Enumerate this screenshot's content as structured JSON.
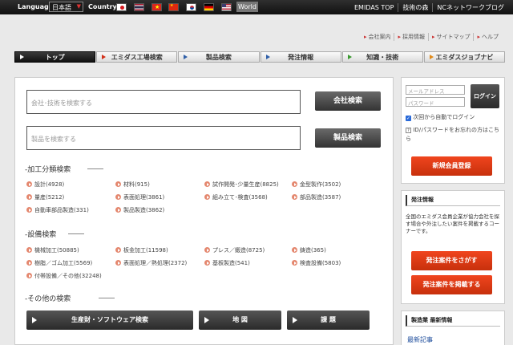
{
  "topbar": {
    "language_label": "Language:",
    "language_value": "日本語",
    "country_label": "Country:",
    "flags": [
      {
        "name": "japan-flag-icon",
        "color": "#ffffff",
        "accent": "#d61a1f"
      },
      {
        "name": "thailand-flag-icon",
        "color": "#2d2a4a",
        "accent": "#a51931"
      },
      {
        "name": "vietnam-flag-icon",
        "color": "#da251d",
        "accent": "#ffff00"
      },
      {
        "name": "china-flag-icon",
        "color": "#de2910",
        "accent": "#ffde00"
      },
      {
        "name": "korea-flag-icon",
        "color": "#ffffff",
        "accent": "#cd2e3a"
      },
      {
        "name": "germany-flag-icon",
        "color": "#000000",
        "accent": "#dd0000"
      },
      {
        "name": "usa-flag-icon",
        "color": "#b22234",
        "accent": "#3c3b6e"
      }
    ],
    "world_label": "World",
    "links": [
      "EMIDAS TOP",
      "技術の森",
      "NCネットワークブログ"
    ]
  },
  "util_links": [
    "会社案内",
    "採用情報",
    "サイトマップ",
    "ヘルプ"
  ],
  "nav": [
    {
      "label": "トップ",
      "color": "#ffffff"
    },
    {
      "label": "エミダス工場検索",
      "color": "#d3301a"
    },
    {
      "label": "製品検索",
      "color": "#2f5fa8"
    },
    {
      "label": "発注情報",
      "color": "#2f5fa8"
    },
    {
      "label": "知識・技術",
      "color": "#3a9a2f"
    },
    {
      "label": "エミダスジョブナビ",
      "color": "#e08a1a"
    }
  ],
  "search": {
    "company_placeholder": "会社･技術を検索する",
    "company_button": "会社検索",
    "product_placeholder": "製品を検索する",
    "product_button": "製品検索"
  },
  "processing": {
    "title": "-加工分類検索",
    "items": [
      "設計(4928)",
      "材料(915)",
      "試作開発･少量生産(8825)",
      "金型製作(3502)",
      "量産(5212)",
      "表面処理(3861)",
      "組み立て･検査(3568)",
      "部品製造(3587)",
      "自動車部品製造(331)",
      "製品製造(3862)"
    ]
  },
  "equipment": {
    "title": "-設備検索",
    "items": [
      "機械加工(50885)",
      "板金加工(11598)",
      "プレス／鍛造(8725)",
      "鋳造(365)",
      "樹脂／ゴム加工(5569)",
      "表面処理／熱処理(2372)",
      "基板製造(541)",
      "検査設備(5803)",
      "付帯設備／その他(32248)"
    ]
  },
  "other": {
    "title": "-その他の検索",
    "buttons": [
      "生産財・ソフトウェア検索",
      "地 図",
      "課 題"
    ]
  },
  "login": {
    "email_placeholder": "メールアドレス",
    "password_placeholder": "パスワード",
    "button": "ログイン",
    "auto_login": "次回から自動でログイン",
    "forgot": "ID/パスワードをお忘れの方はこちら",
    "register_button": "新規会員登録"
  },
  "orders": {
    "title": "発注情報",
    "desc": "全国のエミダス会員企業が協力会社を探す場合や外注したい案件を掲載するコーナーです。",
    "find_button": "発注案件をさがす",
    "post_button": "発注案件を掲載する"
  },
  "news": {
    "title": "製造業 最新情報",
    "latest": "最新記事"
  },
  "colors": {
    "accent_red": "#e8421c",
    "dot": "#e4876e"
  }
}
